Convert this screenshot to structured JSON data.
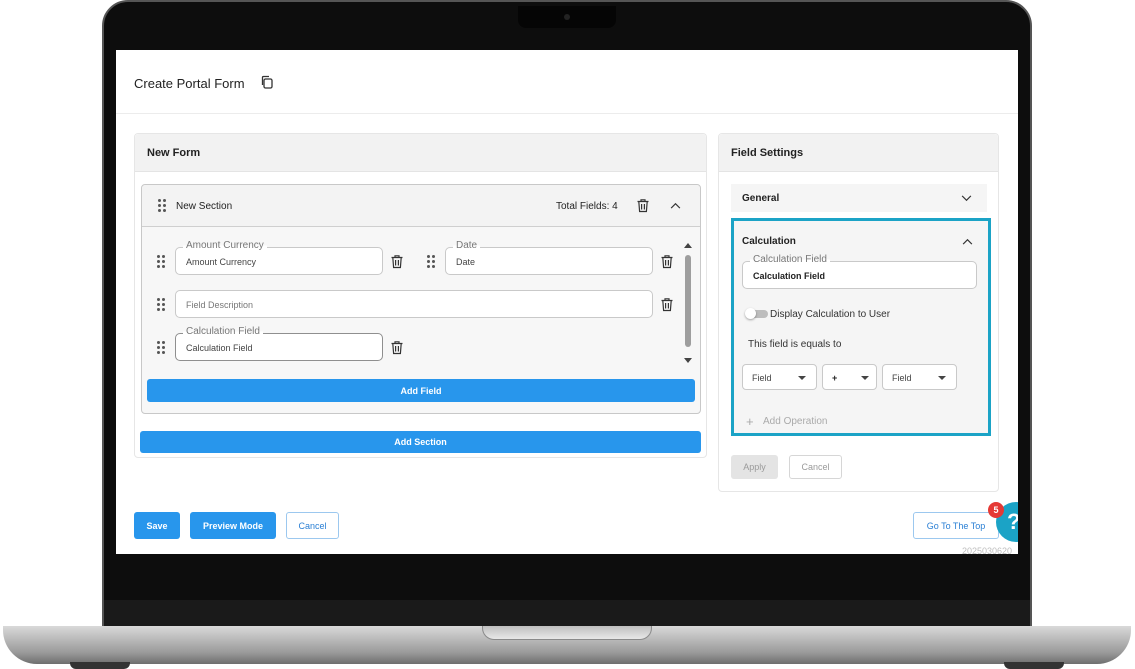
{
  "page": {
    "title": "Create Portal Form"
  },
  "form_panel": {
    "title": "New Form",
    "section": {
      "title": "New Section",
      "total_fields": "Total Fields: 4",
      "fields": {
        "amount_currency": {
          "label": "Amount Currency",
          "value": "Amount Currency"
        },
        "date": {
          "label": "Date",
          "value": "Date"
        },
        "field_description": {
          "placeholder": "Field Description"
        },
        "calculation_field": {
          "label": "Calculation Field",
          "value": "Calculation Field"
        }
      },
      "add_field_label": "Add Field"
    },
    "add_section_label": "Add Section"
  },
  "settings_panel": {
    "title": "Field Settings",
    "general_label": "General",
    "calculation": {
      "title": "Calculation",
      "field_label": "Calculation Field",
      "field_value": "Calculation Field",
      "toggle_label": "Display Calculation to User",
      "toggle_on": false,
      "equals_label": "This field is equals to",
      "operand_left": "Field",
      "operator": "+",
      "operand_right": "Field",
      "add_operation_label": "Add Operation"
    },
    "apply_label": "Apply",
    "cancel_label": "Cancel"
  },
  "footer": {
    "save_label": "Save",
    "preview_label": "Preview Mode",
    "cancel_label": "Cancel",
    "go_top_label": "Go To The Top",
    "help_badge_count": "5",
    "help_icon_glyph": "?",
    "version_text": "2025030620"
  },
  "colors": {
    "primary": "#2896ec",
    "highlight": "#1ba3c6",
    "badge": "#e53935"
  }
}
